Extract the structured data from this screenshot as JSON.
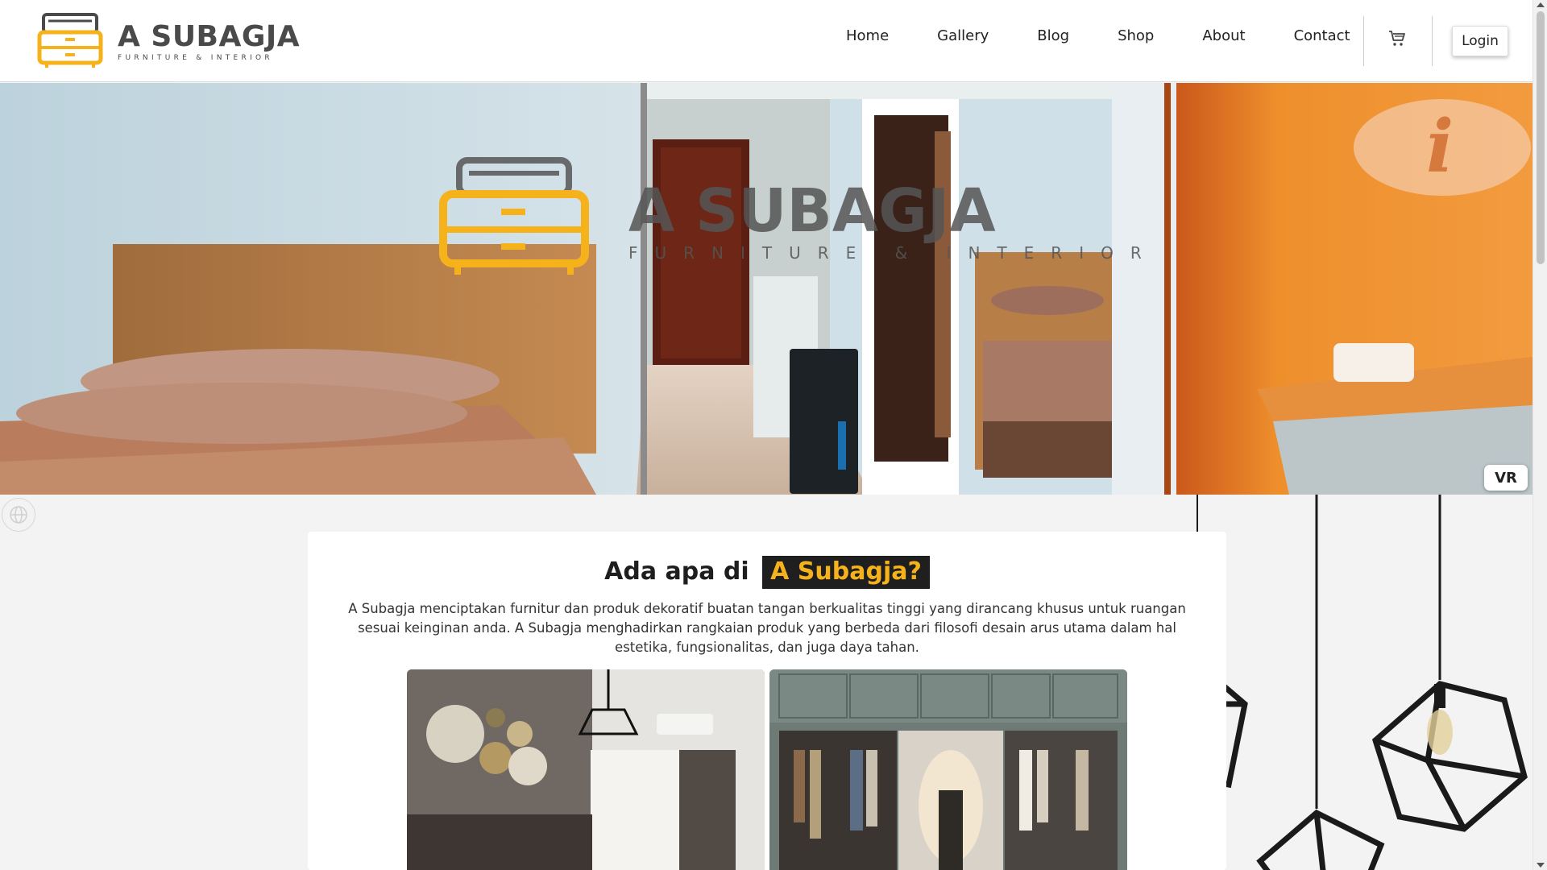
{
  "brand": {
    "name": "A SUBAGJA",
    "tagline": "FURNITURE & INTERIOR",
    "accent_color": "#F5B21B",
    "text_color": "#4A4A4A",
    "logo_icon": "drawer-cabinet-icon"
  },
  "nav": {
    "links": [
      "Home",
      "Gallery",
      "Blog",
      "Shop",
      "About",
      "Contact"
    ],
    "cart_icon": "cart-icon",
    "login_label": "Login"
  },
  "hero": {
    "watermark_name": "A SUBAGJA",
    "watermark_tagline": "FURNITURE & INTERIOR",
    "vr_label": "VR",
    "gyro_icon": "gyroscope-icon"
  },
  "section": {
    "title_prefix": "Ada apa di",
    "title_highlight": "A Subagja?",
    "description": "A Subagja menciptakan furnitur dan produk dekoratif buatan tangan berkualitas tinggi yang dirancang khusus untuk ruangan sesuai keinginan anda. A Subagja menghadirkan rangkaian produk yang berbeda dari filosofi desain arus utama dalam hal estetika, fungsionalitas, dan juga daya tahan."
  },
  "gallery": {
    "items": [
      "bedroom-photo",
      "wardrobe-photo"
    ]
  },
  "decor": {
    "icon": "pendant-lamp-icon"
  }
}
